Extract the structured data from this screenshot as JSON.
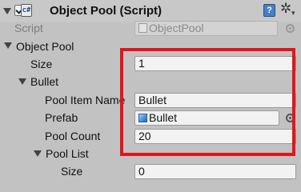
{
  "component": {
    "title": "Object Pool (Script)",
    "script_label": "Script",
    "script_value": "ObjectPool"
  },
  "object_pool": {
    "label": "Object Pool",
    "size_label": "Size",
    "size_value": "1",
    "bullet": {
      "label": "Bullet",
      "pool_item_name_label": "Pool Item Name",
      "pool_item_name_value": "Bullet",
      "prefab_label": "Prefab",
      "prefab_value": "Bullet",
      "pool_count_label": "Pool Count",
      "pool_count_value": "20",
      "pool_list": {
        "label": "Pool List",
        "size_label": "Size",
        "size_value": "0"
      }
    }
  },
  "icons": {
    "foldout": "foldout-arrow-icon",
    "script": "csharp-script-icon",
    "help": "help-book-icon",
    "settings": "gear-icon",
    "prefab": "prefab-cube-icon",
    "object_picker": "object-picker-icon"
  },
  "colors": {
    "panel_background": "#c2c2c2",
    "highlight_border": "#e0161c"
  }
}
